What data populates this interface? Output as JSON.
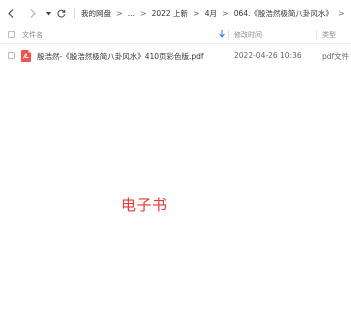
{
  "toolbar": {
    "back_icon": "chevron-left-icon",
    "forward_icon": "chevron-right-icon",
    "dropdown_icon": "caret-down-icon",
    "refresh_icon": "refresh-icon",
    "breadcrumb": [
      "我的网盘",
      "...",
      "2022 上新",
      "4月",
      "064.《殷浩然极简八卦风水》"
    ],
    "separator": ">"
  },
  "columns": {
    "name": "文件名",
    "modified": "修改时间",
    "type": "类型",
    "sort_icon": "arrow-down-icon"
  },
  "files": [
    {
      "icon": "pdf-file-icon",
      "name": "殷浩然-《殷浩然极简八卦风水》410页彩色版.pdf",
      "modified": "2022-04-26 10:36",
      "type": "pdf文件"
    }
  ],
  "overlay": {
    "label": "电子书"
  },
  "colors": {
    "accent_blue": "#3b82f6",
    "pdf_red": "#ef5350",
    "overlay_red": "#e53935"
  }
}
